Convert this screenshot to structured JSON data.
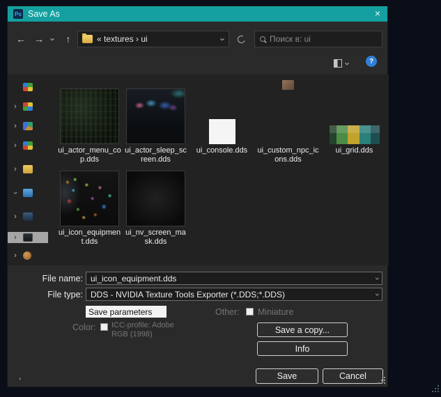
{
  "titlebar": {
    "app_icon": "Ps",
    "title": "Save As"
  },
  "icons": {
    "close": "×",
    "back": "←",
    "forward": "→",
    "up": "↑",
    "chevron": "›",
    "help": "?"
  },
  "navigation": {
    "breadcrumb": "« textures › ui",
    "search_placeholder": "Поиск в: ui"
  },
  "files": [
    {
      "name": "ui_actor_menu_cop.dds"
    },
    {
      "name": "ui_actor_sleep_screen.dds"
    },
    {
      "name": "ui_console.dds"
    },
    {
      "name": "ui_custom_npc_icons.dds"
    },
    {
      "name": "ui_grid.dds"
    },
    {
      "name": "ui_icon_equipment.dds"
    },
    {
      "name": "ui_nv_screen_mask.dds"
    }
  ],
  "form": {
    "file_name_label": "File name:",
    "file_name_value": "ui_icon_equipment.dds",
    "file_type_label": "File type:",
    "file_type_value": "DDS - NVIDIA Texture Tools Exporter (*.DDS;*.DDS)",
    "save_parameters": "Save parameters",
    "color_label": "Color:",
    "icc_label": "ICC-profile: Adobe RGB (1998)",
    "other_label": "Other:",
    "miniature_label": "Miniature",
    "save_copy": "Save a copy...",
    "info": "Info",
    "save": "Save",
    "cancel": "Cancel"
  },
  "colors": {
    "titlebar": "#14a0a0",
    "help_button": "#2f7fd6",
    "photoshop_blue": "#31a8ff"
  },
  "misc": {
    "stray_char": ","
  }
}
